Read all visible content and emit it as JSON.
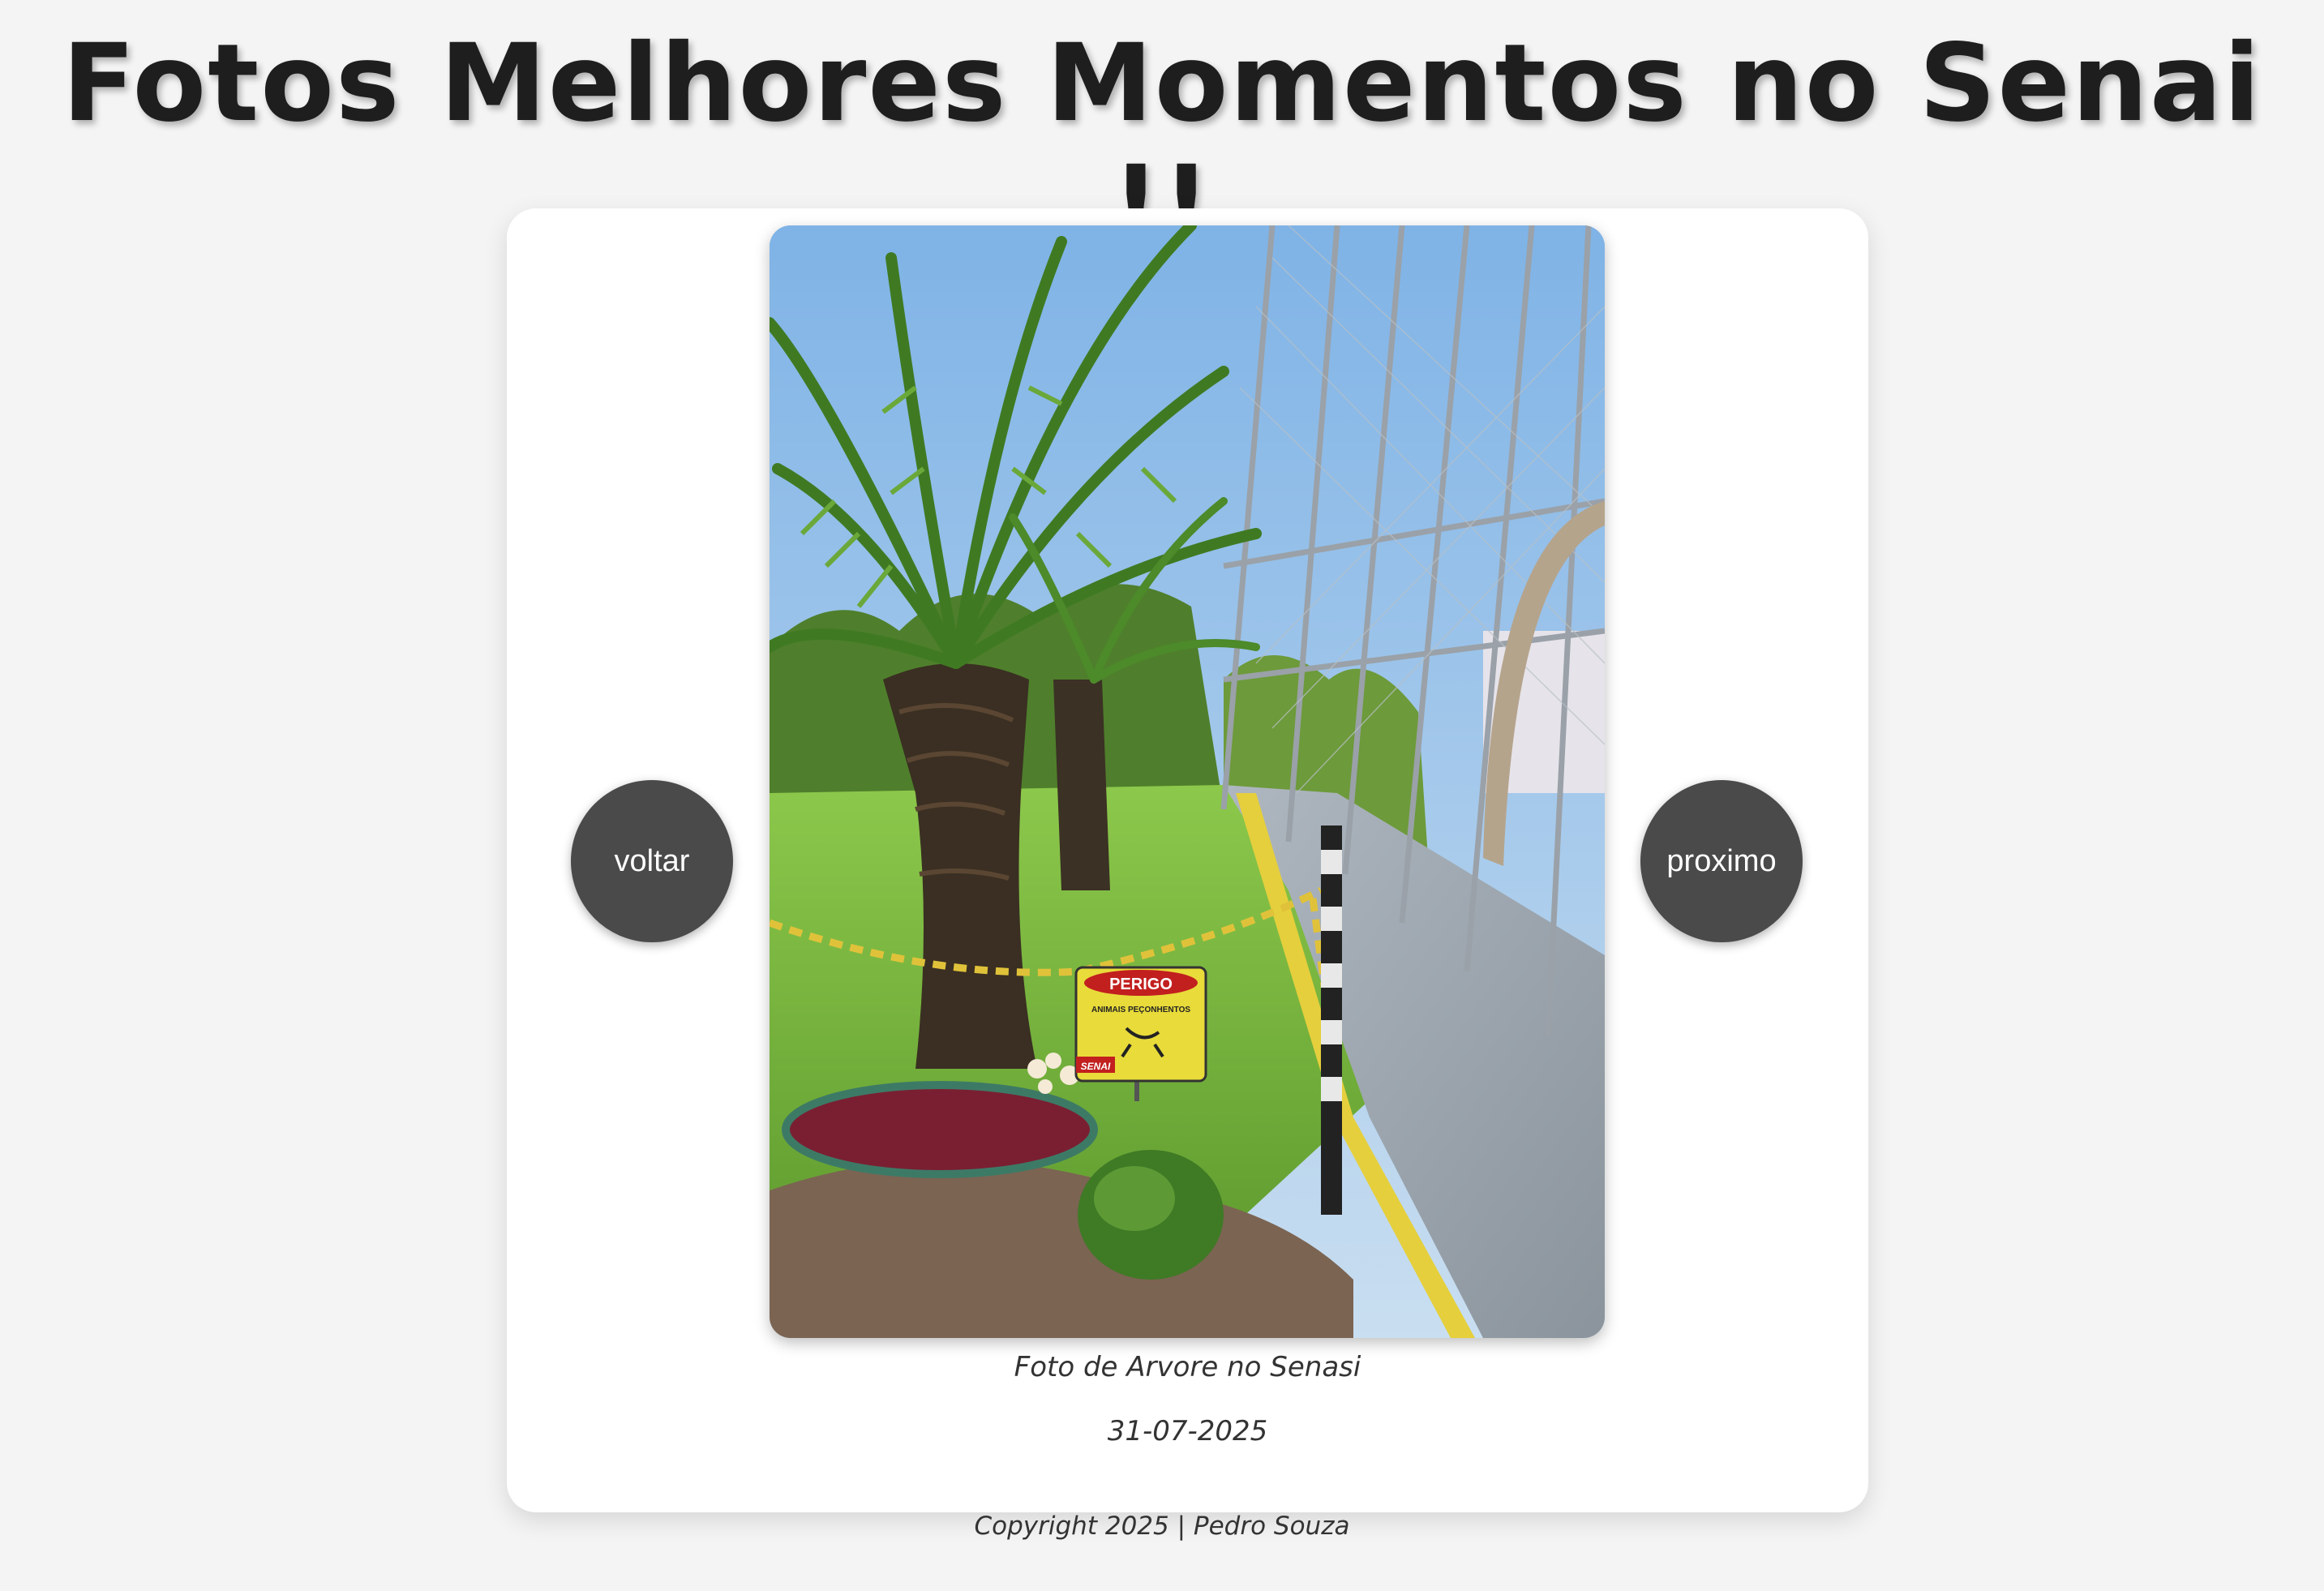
{
  "header": {
    "title": "Fotos Melhores Momentos no Senai !!"
  },
  "carousel": {
    "prev_label": "voltar",
    "next_label": "proximo",
    "photo": {
      "caption": "Foto de Arvore no Senasi",
      "date": "31-07-2025",
      "sign_title": "PERIGO",
      "sign_text": "ANIMAIS PEÇONHENTOS",
      "sign_brand": "SENAI"
    }
  },
  "footer": {
    "text": "Copyright 2025 | Pedro Souza"
  }
}
